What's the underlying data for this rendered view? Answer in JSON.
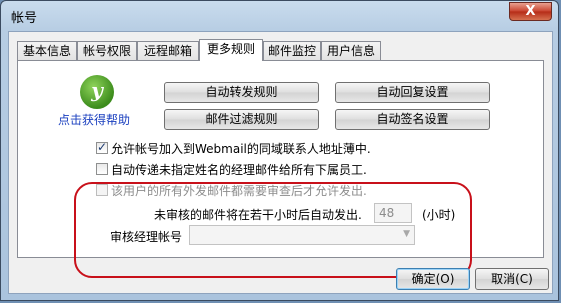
{
  "window": {
    "title": "帐号",
    "close_symbol": "X"
  },
  "tabs": [
    {
      "label": "基本信息"
    },
    {
      "label": "帐号权限"
    },
    {
      "label": "远程邮箱"
    },
    {
      "label": "更多规则"
    },
    {
      "label": "邮件监控"
    },
    {
      "label": "用户信息"
    }
  ],
  "active_tab": "更多规则",
  "help": {
    "logo_letter": "y",
    "label": "点击获得帮助"
  },
  "rule_buttons": {
    "auto_forward": "自动转发规则",
    "auto_reply": "自动回复设置",
    "mail_filter": "邮件过滤规则",
    "auto_signature": "自动签名设置"
  },
  "options": {
    "add_webmail": {
      "label": "允许帐号加入到Webmail的同域联系人地址薄中.",
      "checked": true
    },
    "pass_unassigned": {
      "label": "自动传递未指定姓名的经理邮件给所有下属员工.",
      "checked": false
    },
    "require_review": {
      "label": "该用户的所有外发邮件都需要审查后才允许发出.",
      "checked": false,
      "disabled": true
    }
  },
  "auto_send": {
    "label": "未审核的邮件将在若干小时后自动发出.",
    "hours": "48",
    "unit": "(小时)"
  },
  "reviewer": {
    "label": "审核经理帐号",
    "value": ""
  },
  "footer": {
    "ok_label": "确定(O)",
    "cancel_label": "取消(C)"
  }
}
